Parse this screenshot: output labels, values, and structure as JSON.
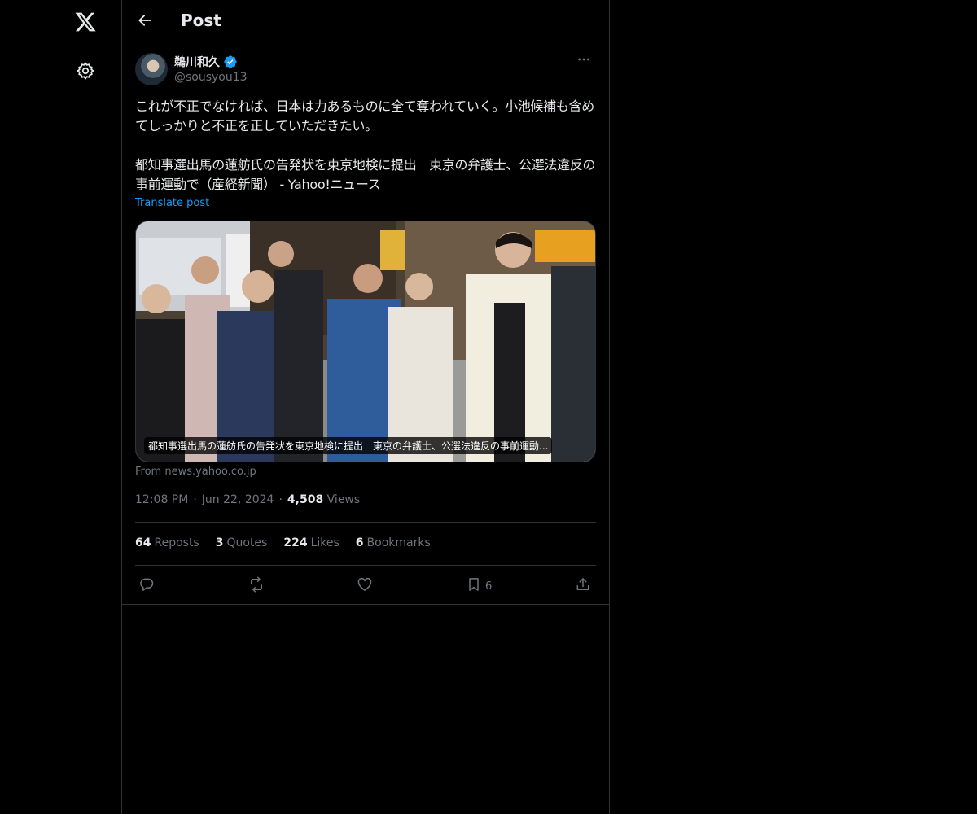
{
  "nav": {
    "logo_icon": "x-logo-icon",
    "settings_icon": "gear-icon"
  },
  "header": {
    "title": "Post",
    "back_icon": "arrow-left-icon"
  },
  "post": {
    "author": {
      "name": "鵜川和久",
      "handle": "@sousyou13",
      "verified": true,
      "verified_color": "#1d9bf0"
    },
    "text": "これが不正でなければ、日本は力あるものに全て奪われていく。小池候補も含めてしっかりと不正を正していただきたい。\n\n都知事選出馬の蓮舫氏の告発状を東京地検に提出　東京の弁護士、公選法違反の事前運動で（産経新聞） - Yahoo!ニュース",
    "translate_label": "Translate post",
    "card": {
      "caption": "都知事選出馬の蓮舫氏の告発状を東京地検に提出　東京の弁護士、公選法違反の事前運動...",
      "source": "From news.yahoo.co.jp"
    },
    "time": "12:08 PM",
    "date": "Jun 22, 2024",
    "views_count": "4,508",
    "views_label": "Views",
    "stats": {
      "reposts_count": "64",
      "reposts_label": "Reposts",
      "quotes_count": "3",
      "quotes_label": "Quotes",
      "likes_count": "224",
      "likes_label": "Likes",
      "bookmarks_count": "6",
      "bookmarks_label": "Bookmarks"
    },
    "actions": {
      "reply_icon": "reply-icon",
      "repost_icon": "repost-icon",
      "like_icon": "heart-icon",
      "bookmark_icon": "bookmark-icon",
      "bookmark_count": "6",
      "share_icon": "share-icon"
    }
  },
  "colors": {
    "background": "#000000",
    "text_primary": "#e7e9ea",
    "text_secondary": "#71767b",
    "accent": "#1d9bf0",
    "border": "#2f3336"
  }
}
